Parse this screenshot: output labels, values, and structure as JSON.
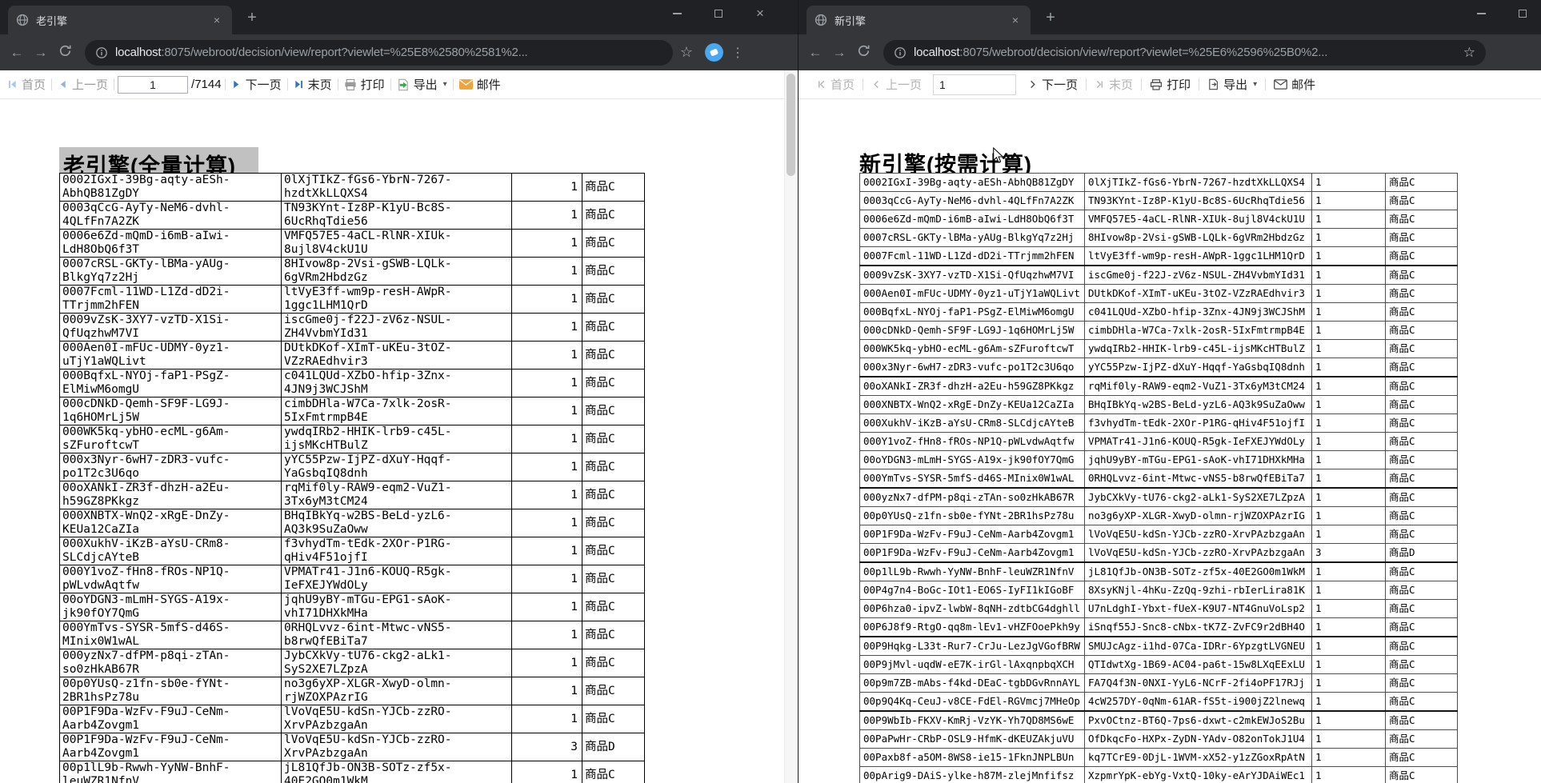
{
  "icons": {
    "back": "←",
    "forward": "→",
    "star": "☆",
    "menu": "⋮",
    "close": "×",
    "new_tab": "+",
    "caret": "▾"
  },
  "left": {
    "tab_title": "老引擎",
    "url": {
      "host": "localhost",
      "rest": ":8075/webroot/decision/view/report?viewlet=%25E8%2580%2581%2..."
    },
    "toolbar": {
      "home": "首页",
      "prev": "上一页",
      "page": "1",
      "total": "/7144",
      "next": "下一页",
      "last": "末页",
      "print": "打印",
      "export": "导出",
      "mail": "邮件"
    },
    "report_title": "老引擎(全量计算)",
    "visible_rows": 22
  },
  "right": {
    "tab_title": "新引擎",
    "url": {
      "host": "localhost",
      "rest": ":8075/webroot/decision/view/report?viewlet=%25E6%2596%25B0%2..."
    },
    "toolbar": {
      "home": "首页",
      "prev": "上一页",
      "page": "1",
      "next": "下一页",
      "last": "末页",
      "print": "打印",
      "export": "导出",
      "mail": "邮件"
    },
    "report_title": "新引擎(按需计算)",
    "visible_rows": 33
  },
  "table": {
    "rows": [
      [
        "0002IGxI-39Bg-aqty-aESh-AbhQB81ZgDY",
        "0lXjTIkZ-fGs6-YbrN-7267-hzdtXkLLQXS4",
        "1",
        "商品C"
      ],
      [
        "0003qCcG-AyTy-NeM6-dvhl-4QLfFn7A2ZK",
        "TN93KYnt-Iz8P-K1yU-Bc8S-6UcRhqTdie56",
        "1",
        "商品C"
      ],
      [
        "0006e6Zd-mQmD-i6mB-aIwi-LdH8ObQ6f3T",
        "VMFQ57E5-4aCL-RlNR-XIUk-8ujl8V4ckU1U",
        "1",
        "商品C"
      ],
      [
        "0007cRSL-GKTy-lBMa-yAUg-BlkgYq7z2Hj",
        "8HIvow8p-2Vsi-gSWB-LQLk-6gVRm2HbdzGz",
        "1",
        "商品C"
      ],
      [
        "0007Fcml-11WD-L1Zd-dD2i-TTrjmm2hFEN",
        "ltVyE3ff-wm9p-resH-AWpR-1ggc1LHM1QrD",
        "1",
        "商品C"
      ],
      [
        "0009vZsK-3XY7-vzTD-X1Si-QfUqzhwM7VI",
        "iscGme0j-f22J-zV6z-NSUL-ZH4VvbmYId31",
        "1",
        "商品C"
      ],
      [
        "000Aen0I-mFUc-UDMY-0yz1-uTjY1aWQLivt",
        "DUtkDKof-XImT-uKEu-3tOZ-VZzRAEdhvir3",
        "1",
        "商品C"
      ],
      [
        "000BqfxL-NYOj-faP1-PSgZ-ElMiwM6omgU",
        "c041LQUd-XZbO-hfip-3Znx-4JN9j3WCJShM",
        "1",
        "商品C"
      ],
      [
        "000cDNkD-Qemh-SF9F-LG9J-1q6HOMrLj5W",
        "cimbDHla-W7Ca-7xlk-2osR-5IxFmtrmpB4E",
        "1",
        "商品C"
      ],
      [
        "000WK5kq-ybHO-ecML-g6Am-sZFuroftcwT",
        "ywdqIRb2-HHIK-lrb9-c45L-ijsMKcHTBulZ",
        "1",
        "商品C"
      ],
      [
        "000x3Nyr-6wH7-zDR3-vufc-po1T2c3U6qo",
        "yYC55Pzw-IjPZ-dXuY-Hqqf-YaGsbqIQ8dnh",
        "1",
        "商品C"
      ],
      [
        "00oXANkI-ZR3f-dhzH-a2Eu-h59GZ8PKkgz",
        "rqMif0ly-RAW9-eqm2-VuZ1-3Tx6yM3tCM24",
        "1",
        "商品C"
      ],
      [
        "000XNBTX-WnQ2-xRgE-DnZy-KEUa12CaZIa",
        "BHqIBkYq-w2BS-BeLd-yzL6-AQ3k9SuZaOww",
        "1",
        "商品C"
      ],
      [
        "000XukhV-iKzB-aYsU-CRm8-SLCdjcAYteB",
        "f3vhydTm-tEdk-2XOr-P1RG-qHiv4F51ojfI",
        "1",
        "商品C"
      ],
      [
        "000Y1voZ-fHn8-fROs-NP1Q-pWLvdwAqtfw",
        "VPMATr41-J1n6-KOUQ-R5gk-IeFXEJYWdOLy",
        "1",
        "商品C"
      ],
      [
        "00oYDGN3-mLmH-SYGS-A19x-jk90fOY7QmG",
        "jqhU9yBY-mTGu-EPG1-sAoK-vhI71DHXkMHa",
        "1",
        "商品C"
      ],
      [
        "000YmTvs-SYSR-5mfS-d46S-MInix0W1wAL",
        "0RHQLvvz-6int-Mtwc-vNS5-b8rwQfEBiTa7",
        "1",
        "商品C"
      ],
      [
        "000yzNx7-dfPM-p8qi-zTAn-so0zHkAB67R",
        "JybCXkVy-tU76-ckg2-aLk1-SyS2XE7LZpzA",
        "1",
        "商品C"
      ],
      [
        "00p0YUsQ-z1fn-sb0e-fYNt-2BR1hsPz78u",
        "no3g6yXP-XLGR-XwyD-olmn-rjWZOXPAzrIG",
        "1",
        "商品C"
      ],
      [
        "00P1F9Da-WzFv-F9uJ-CeNm-Aarb4Zovgm1",
        "lVoVqE5U-kdSn-YJCb-zzRO-XrvPAzbzgaAn",
        "1",
        "商品C"
      ],
      [
        "00P1F9Da-WzFv-F9uJ-CeNm-Aarb4Zovgm1",
        "lVoVqE5U-kdSn-YJCb-zzRO-XrvPAzbzgaAn",
        "3",
        "商品D"
      ],
      [
        "00p1lL9b-Rwwh-YyNW-BnhF-leuWZR1NfnV",
        "jL81QfJb-ON3B-SOTz-zf5x-40E2GO0m1WkM",
        "1",
        "商品C"
      ],
      [
        "00P4g7n4-BoGc-IOt1-EO6S-IyFI1kIGoBF",
        "8XsyKNjl-4hKu-ZzQq-9zhi-rbIerLira81K",
        "1",
        "商品C"
      ],
      [
        "00P6hza0-ipvZ-lwbW-8qNH-zdtbCG4dghll",
        "U7nLdghI-Ybxt-fUeX-K9U7-NT4GnuVoLsp2",
        "1",
        "商品C"
      ],
      [
        "00P6J8f9-RtgO-qq8m-lEv1-vHZFOoePkh9y",
        "iSnqf55J-Snc8-cNbx-tK7Z-ZvFC9r2dBH4O",
        "1",
        "商品C"
      ],
      [
        "00P9Hqkg-L33t-Rur7-CrJu-LezJgVGofBRW",
        "SMUJcAgz-i1hd-07Ca-IDRr-6YpzgtLVGNEU",
        "1",
        "商品C"
      ],
      [
        "00P9jMvl-uqdW-eE7K-irGl-lAxqnpbqXCH",
        "QTIdwtXg-1B69-AC04-pa6t-15w8LXqEExLU",
        "1",
        "商品C"
      ],
      [
        "00p9m7ZB-mAbs-f4kd-DEaC-tgbDGvRnnAYL",
        "FA7Q4f3N-0NXI-YyL6-NCrF-2fi4oPF17RJj",
        "1",
        "商品C"
      ],
      [
        "00p9Q4Kq-CeuJ-v8CE-FdEl-RGVmcj7MHeOp",
        "4cW257DY-0qNm-61AR-fS5t-i900jZ2lnewq",
        "1",
        "商品C"
      ],
      [
        "00P9WbIb-FKXV-KmRj-VzYK-Yh7QD8MS6wE",
        "PxvOCtnz-BT6Q-7ps6-dxwt-c2mkEWJoS2Bu",
        "1",
        "商品C"
      ],
      [
        "00PaPwHr-CRbP-OSL9-HfmK-dKEUZAkjuVU",
        "OfDkqcFo-HXPx-ZyDN-YAdv-O82onTokJ1U4",
        "1",
        "商品C"
      ],
      [
        "00Paxb8f-a5OM-8WS8-ie15-1FknJNPLBUn",
        "kq7TCrE9-0DjL-1WVM-xX52-y1zZGoxRpAtN",
        "1",
        "商品C"
      ],
      [
        "00pArig9-DAiS-ylke-h87M-zlejMnfifsz",
        "XzpmrYpK-ebYg-VxtQ-10ky-eArYJDAiWEc1",
        "1",
        "商品C"
      ]
    ]
  }
}
